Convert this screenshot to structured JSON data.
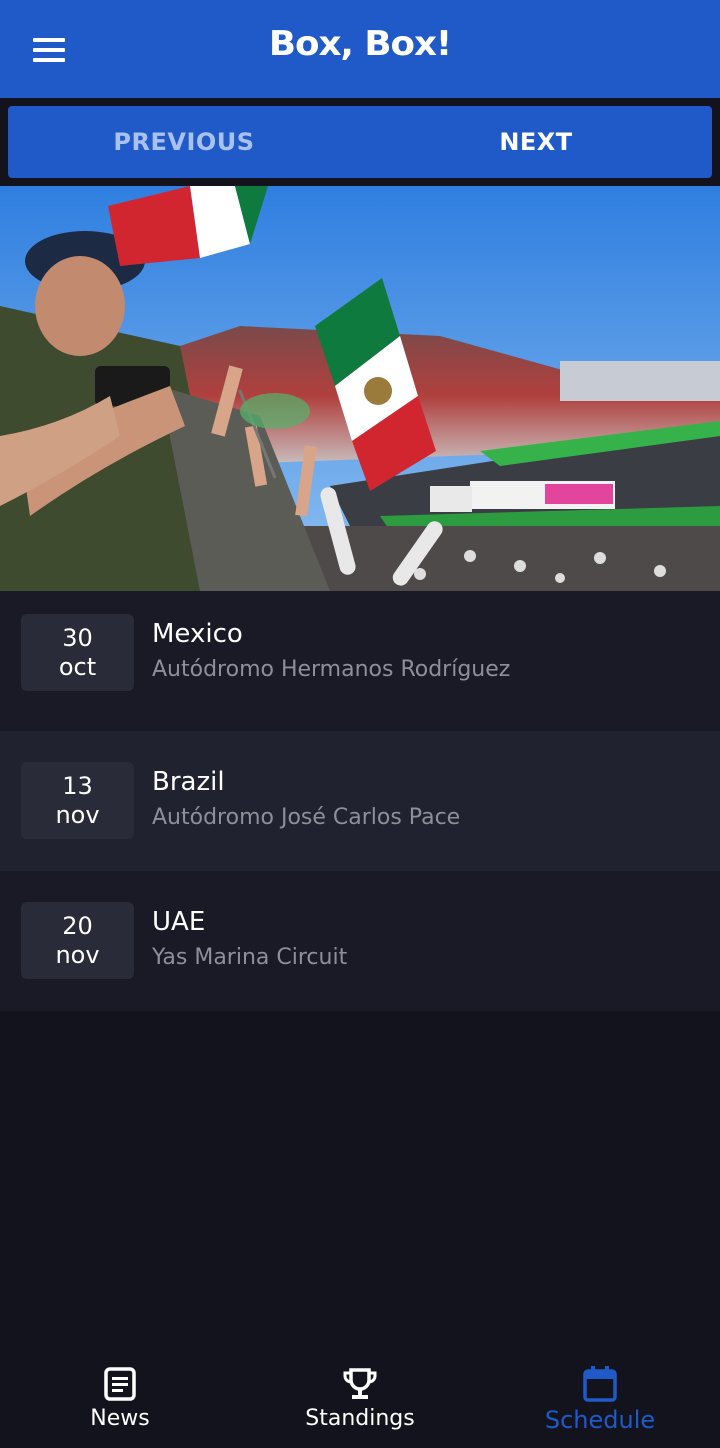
{
  "app": {
    "title": "Box, Box!"
  },
  "pager": {
    "previous_label": "PREVIOUS",
    "next_label": "NEXT"
  },
  "races": [
    {
      "day": "30",
      "month": "oct",
      "country": "Mexico",
      "circuit": "Autódromo Hermanos Rodríguez"
    },
    {
      "day": "13",
      "month": "nov",
      "country": "Brazil",
      "circuit": "Autódromo José Carlos Pace"
    },
    {
      "day": "20",
      "month": "nov",
      "country": "UAE",
      "circuit": "Yas Marina Circuit"
    }
  ],
  "bottom_nav": [
    {
      "label": "News",
      "icon": "news-icon",
      "active": false
    },
    {
      "label": "Standings",
      "icon": "trophy-icon",
      "active": false
    },
    {
      "label": "Schedule",
      "icon": "calendar-icon",
      "active": true
    }
  ],
  "colors": {
    "primary": "#1f5ac8",
    "background": "#13131d",
    "row": "#191a25",
    "row_alt": "#212230",
    "date_box": "#2a2b38",
    "muted_text": "#8e8f99"
  }
}
